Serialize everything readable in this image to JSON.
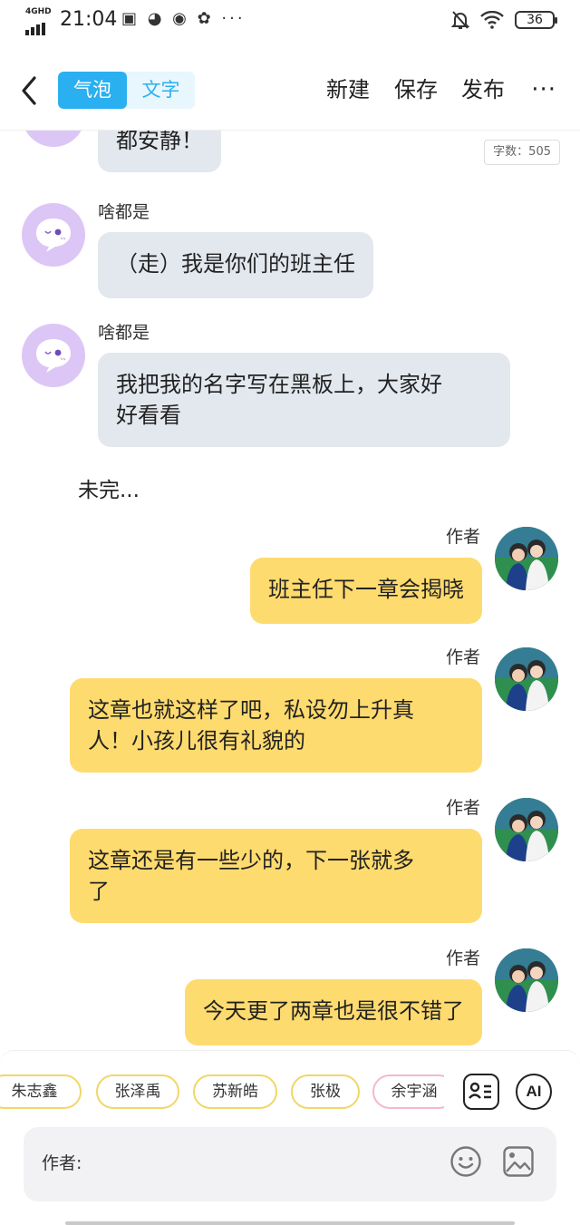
{
  "status_bar": {
    "network": "4GHD",
    "time": "21:04",
    "app_icons": "▣ ◕ ◉ ✿ ···",
    "battery": "36"
  },
  "header": {
    "mode_tabs": [
      "气泡",
      "文字"
    ],
    "actions": {
      "new": "新建",
      "save": "保存",
      "publish": "发布"
    },
    "more": "···"
  },
  "word_count": "字数：505",
  "messages": [
    {
      "side": "left",
      "name": "",
      "text": "都安静！"
    },
    {
      "side": "left",
      "name": "啥都是",
      "text": "（走）我是你们的班主任"
    },
    {
      "side": "left",
      "name": "啥都是",
      "lines": [
        "我把我的名字写在黑板上，大家好",
        "好看看"
      ]
    },
    {
      "side": "narration",
      "text": "未完..."
    },
    {
      "side": "right",
      "name": "作者",
      "text": "班主任下一章会揭晓"
    },
    {
      "side": "right",
      "name": "作者",
      "lines": [
        "这章也就这样了吧，私设勿上升真",
        "人！小孩儿很有礼貌的"
      ]
    },
    {
      "side": "right",
      "name": "作者",
      "lines": [
        "这章还是有一些少的，下一张就多",
        "了"
      ]
    },
    {
      "side": "right",
      "name": "作者",
      "text": "今天更了两章也是很不错了"
    }
  ],
  "characters": [
    "朱志鑫",
    "张泽禹",
    "苏新皓",
    "张极",
    "余宇涵"
  ],
  "tools": {
    "ai": "AI"
  },
  "input": {
    "label": "作者:"
  },
  "colors": {
    "accent": "#2ab0f0",
    "left_bubble": "#e3e8ef",
    "right_bubble": "#fedb6e",
    "avatar_bg": "#dcc6f6"
  }
}
